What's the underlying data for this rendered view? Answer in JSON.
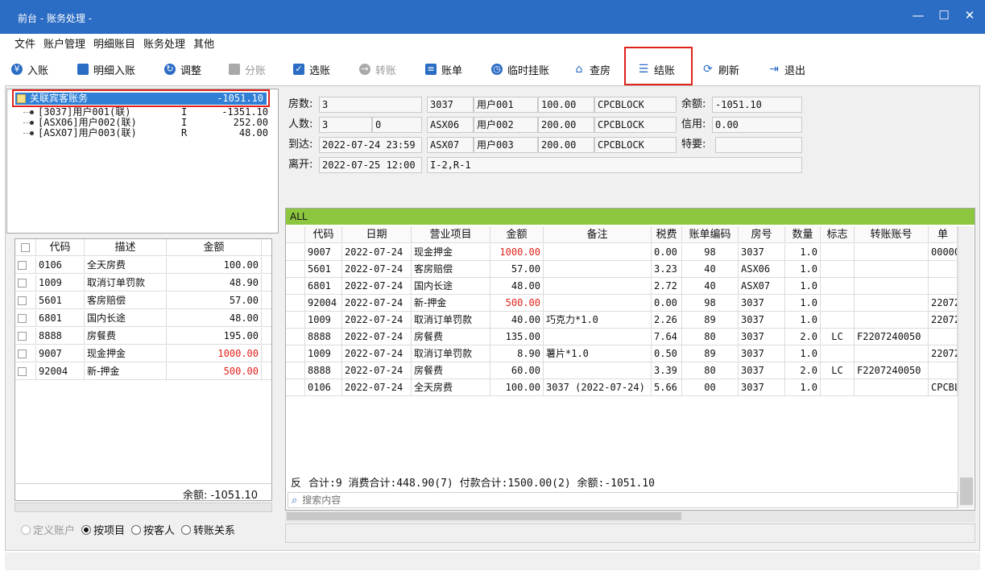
{
  "window": {
    "title": "前台 - 账务处理 -",
    "min": "—",
    "max": "☐",
    "close": "✕"
  },
  "menu": [
    "文件",
    "账户管理",
    "明细账目",
    "账务处理",
    "其他"
  ],
  "toolbar": {
    "post": "入账",
    "detail_post": "明细入账",
    "adjust": "调整",
    "split": "分账",
    "select": "选账",
    "transfer": "转账",
    "bill": "账单",
    "temp_hold": "临时挂账",
    "check_room": "查房",
    "checkout": "结账",
    "refresh": "刷新",
    "exit": "退出"
  },
  "tree": {
    "root": {
      "label": "关联宾客账务",
      "amount": "-1051.10"
    },
    "nodes": [
      {
        "name": "[3037]用户001(联)",
        "flag": "I",
        "amount": "-1351.10"
      },
      {
        "name": "[ASX06]用户002(联)",
        "flag": "I",
        "amount": "252.00"
      },
      {
        "name": "[ASX07]用户003(联)",
        "flag": "R",
        "amount": "48.00"
      }
    ]
  },
  "left_table": {
    "headers": [
      "代码",
      "描述",
      "金额"
    ],
    "rows": [
      {
        "code": "0106",
        "desc": "全天房费",
        "amount": "100.00",
        "red": false
      },
      {
        "code": "1009",
        "desc": "取消订单罚款",
        "amount": "48.90",
        "red": false
      },
      {
        "code": "5601",
        "desc": "客房赔偿",
        "amount": "57.00",
        "red": false
      },
      {
        "code": "6801",
        "desc": "国内长途",
        "amount": "48.00",
        "red": false
      },
      {
        "code": "8888",
        "desc": "房餐费",
        "amount": "195.00",
        "red": false
      },
      {
        "code": "9007",
        "desc": "现金押金",
        "amount": "1000.00",
        "red": true
      },
      {
        "code": "92004",
        "desc": "新-押金",
        "amount": "500.00",
        "red": true
      }
    ],
    "balance": "余额: -1051.10"
  },
  "radios": [
    {
      "label": "定义账户",
      "checked": false,
      "disabled": true
    },
    {
      "label": "按项目",
      "checked": true,
      "disabled": false
    },
    {
      "label": "按客人",
      "checked": false,
      "disabled": false
    },
    {
      "label": "转账关系",
      "checked": false,
      "disabled": false
    }
  ],
  "info": {
    "rooms_label": "房数:",
    "rooms": "3",
    "people_label": "人数:",
    "people": "3",
    "people2": "0",
    "arrive_label": "到达:",
    "arrive": "2022-07-24 23:59",
    "depart_label": "离开:",
    "depart": "2022-07-25 12:00",
    "guests": [
      {
        "room": "3037",
        "user": "用户001",
        "price": "100.00",
        "code": "CPCBLOCK"
      },
      {
        "room": "ASX06",
        "user": "用户002",
        "price": "200.00",
        "code": "CPCBLOCK"
      },
      {
        "room": "ASX07",
        "user": "用户003",
        "price": "200.00",
        "code": "CPCBLOCK"
      }
    ],
    "status_note": "I-2,R-1",
    "balance_label": "余额:",
    "balance": "-1051.10",
    "credit_label": "信用:",
    "credit": "0.00",
    "special_label": "特要:",
    "special": ""
  },
  "grid": {
    "filter": "ALL",
    "headers": [
      "代码",
      "日期",
      "营业项目",
      "金额",
      "备注",
      "税费",
      "账单编码",
      "房号",
      "数量",
      "标志",
      "转账账号",
      "单"
    ],
    "rows": [
      {
        "code": "9007",
        "date": "2022-07-24",
        "item": "现金押金",
        "amount": "1000.00",
        "red": true,
        "note": "",
        "tax": "0.00",
        "bill": "98",
        "room": "3037",
        "qty": "1.0",
        "flag": "",
        "transfer": "",
        "extra": "00000"
      },
      {
        "code": "5601",
        "date": "2022-07-24",
        "item": "客房赔偿",
        "amount": "57.00",
        "red": false,
        "note": "",
        "tax": "3.23",
        "bill": "40",
        "room": "ASX06",
        "qty": "1.0",
        "flag": "",
        "transfer": "",
        "extra": ""
      },
      {
        "code": "6801",
        "date": "2022-07-24",
        "item": "国内长途",
        "amount": "48.00",
        "red": false,
        "note": "",
        "tax": "2.72",
        "bill": "40",
        "room": "ASX07",
        "qty": "1.0",
        "flag": "",
        "transfer": "",
        "extra": ""
      },
      {
        "code": "92004",
        "date": "2022-07-24",
        "item": "新-押金",
        "amount": "500.00",
        "red": true,
        "note": "",
        "tax": "0.00",
        "bill": "98",
        "room": "3037",
        "qty": "1.0",
        "flag": "",
        "transfer": "",
        "extra": "22072"
      },
      {
        "code": "1009",
        "date": "2022-07-24",
        "item": "取消订单罚款",
        "amount": "40.00",
        "red": false,
        "note": "巧克力*1.0",
        "tax": "2.26",
        "bill": "89",
        "room": "3037",
        "qty": "1.0",
        "flag": "",
        "transfer": "",
        "extra": "22072"
      },
      {
        "code": "8888",
        "date": "2022-07-24",
        "item": "房餐费",
        "amount": "135.00",
        "red": false,
        "note": "",
        "tax": "7.64",
        "bill": "80",
        "room": "3037",
        "qty": "2.0",
        "flag": "LC",
        "transfer": "F2207240050",
        "extra": ""
      },
      {
        "code": "1009",
        "date": "2022-07-24",
        "item": "取消订单罚款",
        "amount": "8.90",
        "red": false,
        "note": "薯片*1.0",
        "tax": "0.50",
        "bill": "89",
        "room": "3037",
        "qty": "1.0",
        "flag": "",
        "transfer": "",
        "extra": "22072"
      },
      {
        "code": "8888",
        "date": "2022-07-24",
        "item": "房餐费",
        "amount": "60.00",
        "red": false,
        "note": "",
        "tax": "3.39",
        "bill": "80",
        "room": "3037",
        "qty": "2.0",
        "flag": "LC",
        "transfer": "F2207240050",
        "extra": ""
      },
      {
        "code": "0106",
        "date": "2022-07-24",
        "item": "全天房费",
        "amount": "100.00",
        "red": false,
        "note": "3037 (2022-07-24)",
        "tax": "5.66",
        "bill": "00",
        "room": "3037",
        "qty": "1.0",
        "flag": "",
        "transfer": "",
        "extra": "CPCBL"
      }
    ],
    "reverse": "反",
    "summary": "合计:9  消费合计:448.90(7)  付款合计:1500.00(2)  余额:-1051.10",
    "search_placeholder": "搜索内容"
  },
  "colors": {
    "titlebar": "#2b6cc4",
    "highlight_red": "#e0221b",
    "filter_bar": "#8cc63f",
    "selection": "#2f7fd6"
  }
}
